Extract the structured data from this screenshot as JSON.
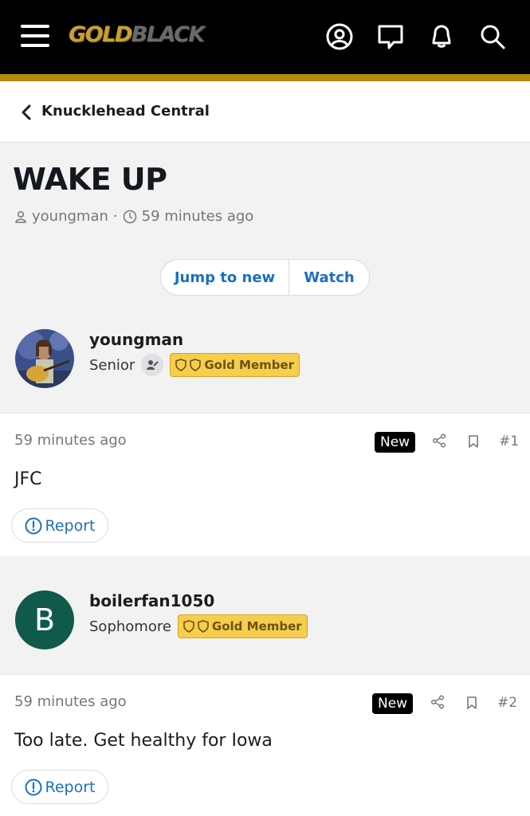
{
  "header": {
    "logo_gold": "GOLD",
    "logo_black": "BLACK",
    "colors": {
      "bar": "#000000",
      "accent": "#b58a0a",
      "link": "#1a6fc0"
    },
    "icons": [
      "menu-icon",
      "account-icon",
      "messages-icon",
      "alerts-icon",
      "search-icon"
    ]
  },
  "breadcrumb": {
    "label": "Knucklehead Central"
  },
  "thread": {
    "title": "WAKE UP",
    "author": "youngman",
    "separator": "·",
    "time": "59 minutes ago",
    "jump_label": "Jump to new",
    "watch_label": "Watch"
  },
  "posts": [
    {
      "username": "youngman",
      "rank": "Senior",
      "badge": "Gold Member",
      "time": "59 minutes ago",
      "new_label": "New",
      "number": "#1",
      "text": "JFC",
      "report_label": "Report"
    },
    {
      "username": "boilerfan1050",
      "avatar_letter": "B",
      "rank": "Sophomore",
      "badge": "Gold Member",
      "time": "59 minutes ago",
      "new_label": "New",
      "number": "#2",
      "text": "Too late. Get healthy for Iowa",
      "report_label": "Report"
    }
  ]
}
